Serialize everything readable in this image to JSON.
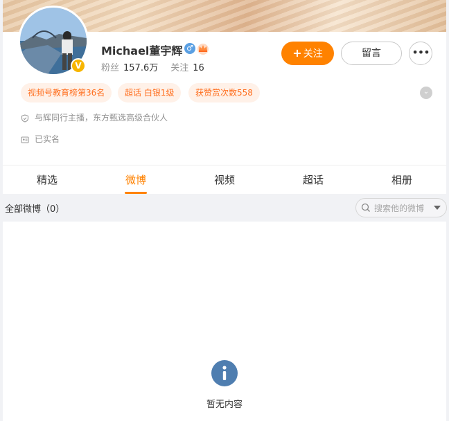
{
  "profile": {
    "name": "Michael董宇辉",
    "gender_symbol": "♂",
    "verified_symbol": "V",
    "fans_label": "粉丝",
    "fans_value": "157.6万",
    "following_label": "关注",
    "following_value": "16"
  },
  "actions": {
    "follow_plus": "+",
    "follow_label": "关注",
    "message_label": "留言",
    "more_label": "•••"
  },
  "tags": [
    {
      "label": "视频号教育榜第36名"
    },
    {
      "label": "超话 白银1级"
    },
    {
      "label": "获赞赏次数558"
    }
  ],
  "info": {
    "description": "与辉同行主播，东方甄选高级合伙人",
    "realname": "已实名"
  },
  "tabs": [
    {
      "label": "精选"
    },
    {
      "label": "微博"
    },
    {
      "label": "视频"
    },
    {
      "label": "超话"
    },
    {
      "label": "相册"
    }
  ],
  "active_tab": "微博",
  "feed": {
    "filter_title": "全部微博（0）",
    "search_placeholder": "搜索他的微博",
    "empty_symbol": "i",
    "empty_text": "暂无内容"
  },
  "colors": {
    "accent": "#ff8200",
    "tag_bg": "#fff1e8",
    "tag_text": "#ff6f1f",
    "verified": "#f7b500",
    "gender": "#5ba0e3",
    "empty_icon": "#4f7eb0"
  }
}
